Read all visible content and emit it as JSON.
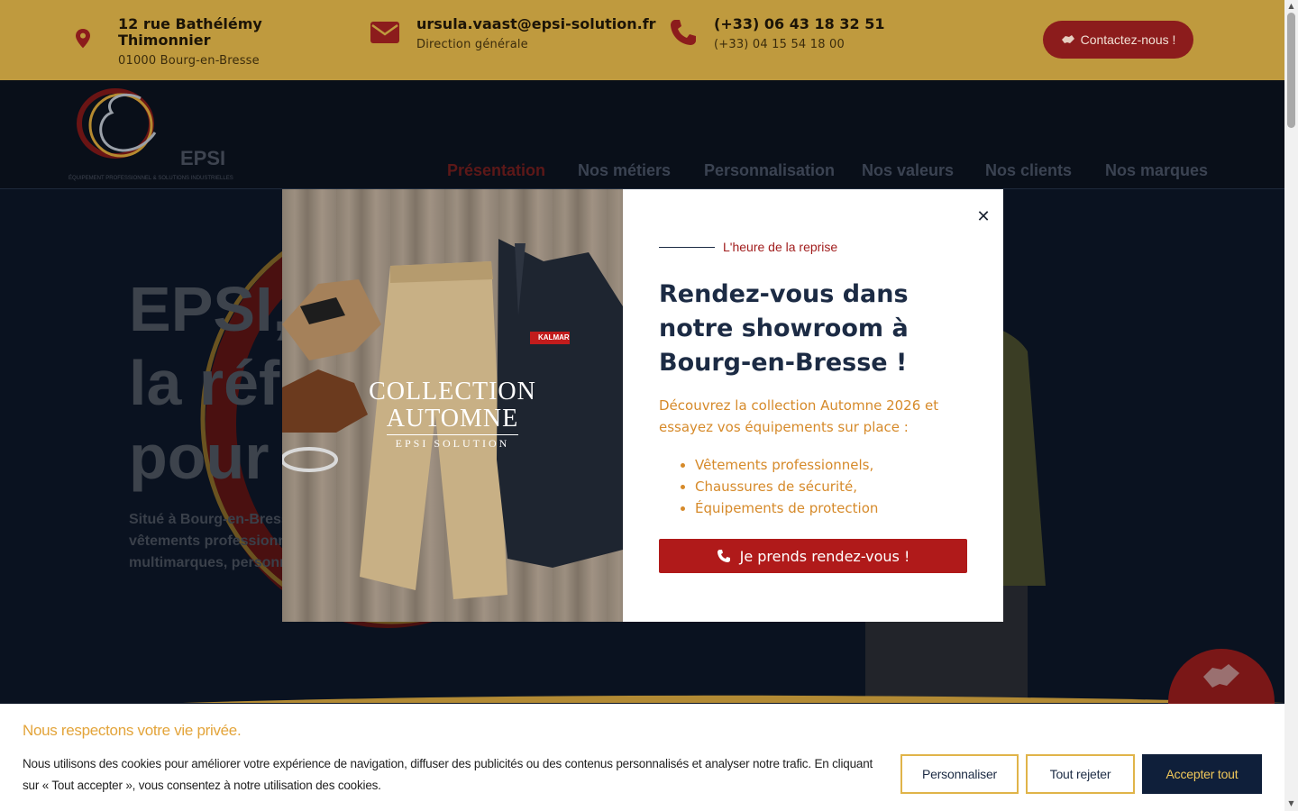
{
  "topbar": {
    "address": {
      "line1": "12 rue Bathélémy",
      "line2": "Thimonnier",
      "sub": "01000 Bourg-en-Bresse",
      "icon": "map-pin-icon"
    },
    "email": {
      "title": "ursula.vaast@epsi-solution.fr",
      "sub": "Direction générale",
      "icon": "envelope-icon"
    },
    "phone": {
      "title": "(+33) 06 43 18 32 51",
      "sub": "(+33) 04 15 54 18 00",
      "icon": "phone-icon"
    },
    "contact_label": "Contactez-nous !"
  },
  "logo": {
    "text": "EPSI",
    "tagline": "ÉQUIPEMENT PROFESSIONNEL & SOLUTIONS INDUSTRIELLES"
  },
  "nav": {
    "items": [
      {
        "label": "Présentation",
        "active": true
      },
      {
        "label": "Nos métiers"
      },
      {
        "label": "Personnalisation"
      },
      {
        "label": "Nos valeurs"
      },
      {
        "label": "Nos clients"
      },
      {
        "label": "Nos marques"
      }
    ]
  },
  "hero": {
    "title": "EPSI,\nla réf\npour",
    "text": "Situé à Bourg-en-Bress\nvêtements professionn\nmultimarques, personn"
  },
  "modal": {
    "image_text": {
      "line1": "COLLECTION",
      "line2": "AUTOMNE",
      "line3": "EPSI SOLUTION",
      "brand": "KALMAR"
    },
    "eyebrow": "L'heure de la reprise",
    "heading": "Rendez-vous dans\nnotre showroom à\nBourg-en-Bresse !",
    "paragraph": "Découvrez la collection Automne 2026 et essayez vos équipements sur place :",
    "list": [
      "Vêtements professionnels,",
      "Chaussures de sécurité,",
      "Équipements de protection"
    ],
    "cta_label": "Je prends rendez-vous !",
    "close_symbol": "✕"
  },
  "cookie": {
    "title": "Nous respectons votre vie privée.",
    "text": "Nous utilisons des cookies pour améliorer votre expérience de navigation, diffuser des publicités ou des contenus personnalisés et analyser notre trafic. En cliquant sur « Tout accepter », vous consentez à notre utilisation des cookies.",
    "buttons": {
      "customize": "Personnaliser",
      "reject": "Tout rejeter",
      "accept": "Accepter tout"
    }
  },
  "colors": {
    "gold": "#bf9a3e",
    "navy": "#1c2b44",
    "red": "#b01a1a",
    "orange_text": "#d68a2a"
  }
}
